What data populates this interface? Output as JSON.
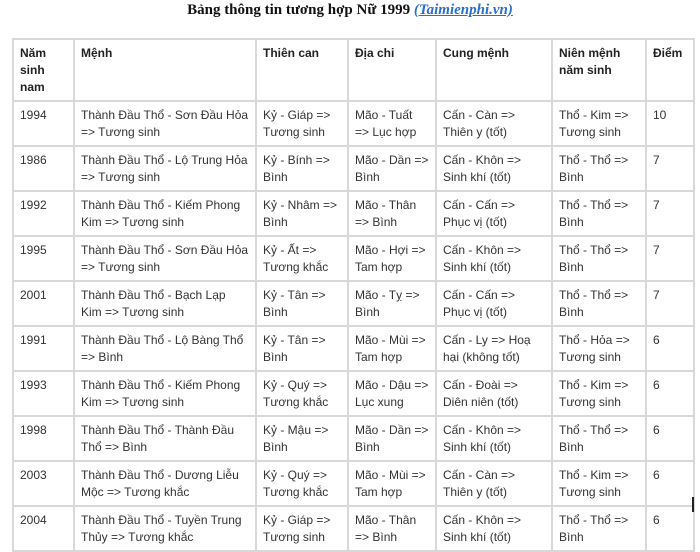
{
  "title": {
    "text": "Bảng thông tin tương hợp Nữ 1999 ",
    "link": "(Taimienphi.vn)",
    "link_color": "#2a6fc9"
  },
  "table": {
    "headers": [
      "Năm sinh nam",
      "Mệnh",
      "Thiên can",
      "Địa chi",
      "Cung mệnh",
      "Niên mệnh năm sinh",
      "Điểm"
    ],
    "rows": [
      [
        "1994",
        "Thành Đầu Thổ - Sơn Đầu Hỏa => Tương sinh",
        "Kỷ - Giáp => Tương sinh",
        "Mão - Tuất => Lục hợp",
        "Cấn - Càn => Thiên y (tốt)",
        "Thổ - Kim => Tương sinh",
        "10"
      ],
      [
        "1986",
        "Thành Đầu Thổ - Lộ Trung Hỏa => Tương sinh",
        "Kỷ - Bính => Bình",
        "Mão - Dần => Bình",
        "Cấn - Khôn => Sinh khí (tốt)",
        "Thổ - Thổ => Bình",
        "7"
      ],
      [
        "1992",
        "Thành Đầu Thổ - Kiếm Phong Kim => Tương sinh",
        "Kỷ - Nhâm => Bình",
        "Mão - Thân => Bình",
        "Cấn - Cấn => Phục vị (tốt)",
        "Thổ - Thổ => Bình",
        "7"
      ],
      [
        "1995",
        "Thành Đầu Thổ - Sơn Đầu Hỏa => Tương sinh",
        "Kỷ - Ất => Tương khắc",
        "Mão - Hợi => Tam hợp",
        "Cấn - Khôn => Sinh khí (tốt)",
        "Thổ - Thổ => Bình",
        "7"
      ],
      [
        "2001",
        "Thành Đầu Thổ - Bạch Lạp Kim => Tương sinh",
        "Kỷ - Tân => Bình",
        "Mão - Tỵ => Bình",
        "Cấn - Cấn => Phục vị (tốt)",
        "Thổ - Thổ => Bình",
        "7"
      ],
      [
        "1991",
        "Thành Đầu Thổ - Lộ Bàng Thổ => Bình",
        "Kỷ - Tân => Bình",
        "Mão - Mùi => Tam hợp",
        "Cấn - Ly => Hoạ hại (không tốt)",
        "Thổ - Hỏa => Tương sinh",
        "6"
      ],
      [
        "1993",
        "Thành Đầu Thổ - Kiếm Phong Kim => Tương sinh",
        "Kỷ - Quý => Tương khắc",
        "Mão - Dậu => Lục xung",
        "Cấn - Đoài => Diên niên (tốt)",
        "Thổ - Kim => Tương sinh",
        "6"
      ],
      [
        "1998",
        "Thành Đầu Thổ - Thành Đầu Thổ => Bình",
        "Kỷ - Mậu => Bình",
        "Mão - Dần => Bình",
        "Cấn - Khôn => Sinh khí (tốt)",
        "Thổ - Thổ => Bình",
        "6"
      ],
      [
        "2003",
        "Thành Đầu Thổ - Dương Liễu Mộc => Tương khắc",
        "Kỷ - Quý => Tương khắc",
        "Mão - Mùi => Tam hợp",
        "Cấn - Càn => Thiên y (tốt)",
        "Thổ - Kim => Tương sinh",
        "6"
      ],
      [
        "2004",
        "Thành Đầu Thổ - Tuyền Trung Thủy => Tương khắc",
        "Kỷ - Giáp => Tương sinh",
        "Mão - Thân => Bình",
        "Cấn - Khôn => Sinh khí (tốt)",
        "Thổ - Thổ => Bình",
        "6"
      ]
    ]
  }
}
